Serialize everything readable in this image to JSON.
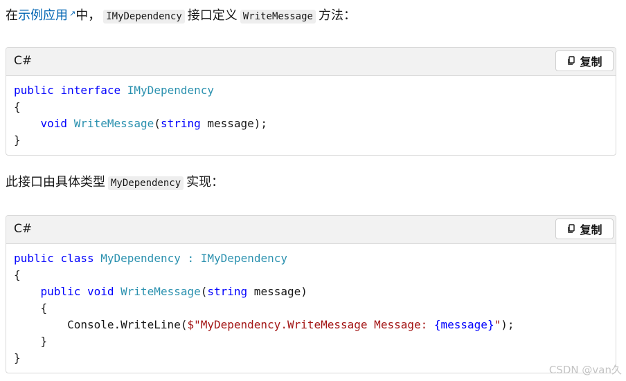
{
  "intro": {
    "prefix": "在",
    "link": "示例应用",
    "after_link": "中，",
    "code1": "IMyDependency",
    "middle": "接口定义",
    "code2": "WriteMessage",
    "suffix": "方法："
  },
  "block1": {
    "lang": "C#",
    "copy_label": "复制",
    "lines": [
      [
        {
          "t": "public",
          "c": "kw"
        },
        {
          "t": " "
        },
        {
          "t": "interface",
          "c": "kw"
        },
        {
          "t": " "
        },
        {
          "t": "IMyDependency",
          "c": "ty"
        }
      ],
      [
        {
          "t": "{"
        }
      ],
      [
        {
          "t": "    "
        },
        {
          "t": "void",
          "c": "kw"
        },
        {
          "t": " "
        },
        {
          "t": "WriteMessage",
          "c": "ty"
        },
        {
          "t": "("
        },
        {
          "t": "string",
          "c": "kw"
        },
        {
          "t": " message);"
        }
      ],
      [
        {
          "t": "}"
        }
      ]
    ]
  },
  "para2": {
    "prefix": "此接口由具体类型",
    "code": "MyDependency",
    "suffix": "实现："
  },
  "block2": {
    "lang": "C#",
    "copy_label": "复制",
    "lines": [
      [
        {
          "t": "public",
          "c": "kw"
        },
        {
          "t": " "
        },
        {
          "t": "class",
          "c": "kw"
        },
        {
          "t": " "
        },
        {
          "t": "MyDependency",
          "c": "ty"
        },
        {
          "t": " "
        },
        {
          "t": ":",
          "c": "ty"
        },
        {
          "t": " "
        },
        {
          "t": "IMyDependency",
          "c": "ty"
        }
      ],
      [
        {
          "t": "{"
        }
      ],
      [
        {
          "t": "    "
        },
        {
          "t": "public",
          "c": "kw"
        },
        {
          "t": " "
        },
        {
          "t": "void",
          "c": "kw"
        },
        {
          "t": " "
        },
        {
          "t": "WriteMessage",
          "c": "ty"
        },
        {
          "t": "("
        },
        {
          "t": "string",
          "c": "kw"
        },
        {
          "t": " message)"
        }
      ],
      [
        {
          "t": "    {"
        }
      ],
      [
        {
          "t": "        Console.WriteLine("
        },
        {
          "t": "$\"MyDependency.",
          "c": "st"
        },
        {
          "t": "WriteMessage",
          "c": "st"
        },
        {
          "t": " Message: ",
          "c": "st"
        },
        {
          "t": "{message}",
          "c": "kw"
        },
        {
          "t": "\"",
          "c": "st"
        },
        {
          "t": ");"
        }
      ],
      [
        {
          "t": "    }"
        }
      ],
      [
        {
          "t": "}"
        }
      ]
    ]
  },
  "watermark": "CSDN @van久"
}
